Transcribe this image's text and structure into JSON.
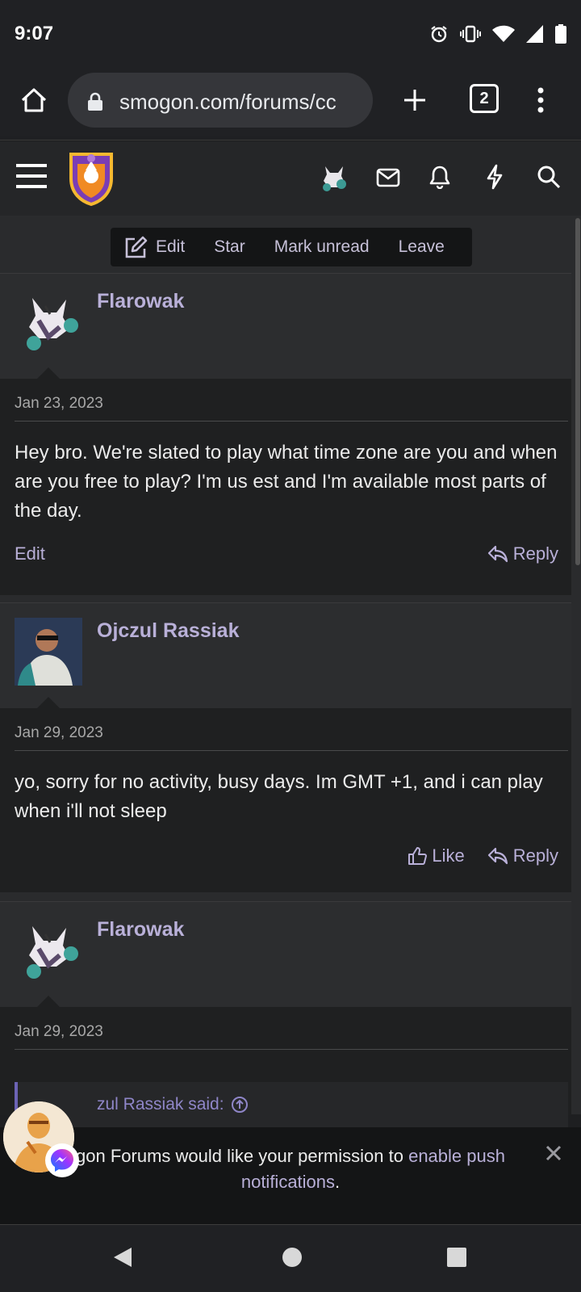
{
  "status": {
    "time": "9:07"
  },
  "browser": {
    "url": "smogon.com/forums/cc",
    "tab_count": "2"
  },
  "toolbar": {
    "edit_label": "Edit",
    "star_label": "Star",
    "mark_unread_label": "Mark unread",
    "leave_label": "Leave"
  },
  "posts": [
    {
      "username": "Flarowak",
      "date": "Jan 23, 2023",
      "text": "Hey bro. We're slated to play what time zone are you and when are you free to play? I'm us est and I'm available most parts of the day.",
      "left_action": "Edit",
      "reply_label": "Reply"
    },
    {
      "username": "Ojczul Rassiak",
      "date": "Jan 29, 2023",
      "text": "yo, sorry for no activity, busy days. Im GMT +1, and i can play when i'll not sleep",
      "like_label": "Like",
      "reply_label": "Reply"
    },
    {
      "username": "Flarowak",
      "date": "Jan 29, 2023",
      "quote_author": "zul Rassiak said:"
    }
  ],
  "notification": {
    "text_before": "gon Forums would like your permission to ",
    "link_text": "enable push notifications",
    "text_after": "."
  },
  "colors": {
    "accent": "#b9b0d8",
    "background": "#1e1f21",
    "quote_bar": "#6c63b5"
  }
}
